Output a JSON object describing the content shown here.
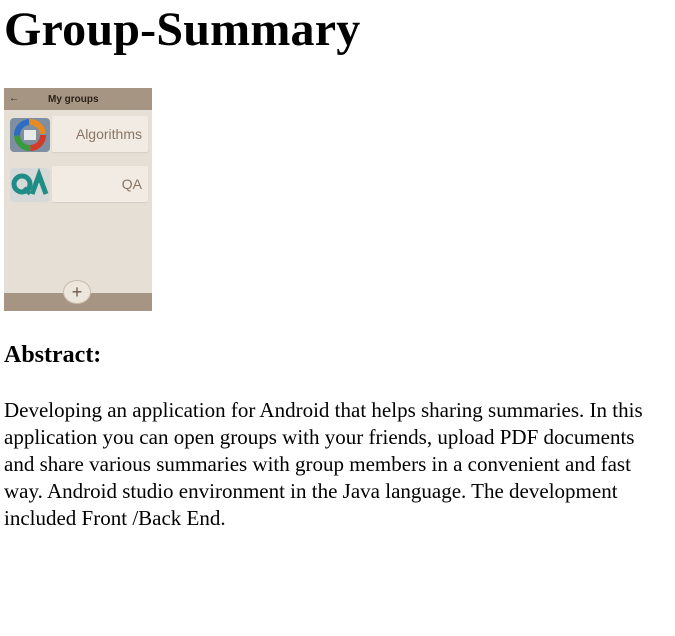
{
  "page": {
    "title": "Group-Summary",
    "abstract_heading": "Abstract:",
    "abstract_text": "Developing an application for Android that helps sharing summaries. In this application you can open groups with your friends, upload PDF documents and share various summaries with group members in a convenient and fast way. Android studio environment in the Java language. The development included Front /Back End."
  },
  "phone": {
    "back_glyph": "←",
    "title": "My groups",
    "groups": [
      {
        "name": "Algorithms",
        "icon": "algorithms-logo-icon"
      },
      {
        "name": "QA",
        "icon": "qa-logo-icon"
      }
    ],
    "fab_glyph": "+",
    "colors": {
      "bar": "#a69583",
      "background": "#e6dfd5",
      "card": "#f1ebe3",
      "card_text": "#8a7565"
    }
  }
}
